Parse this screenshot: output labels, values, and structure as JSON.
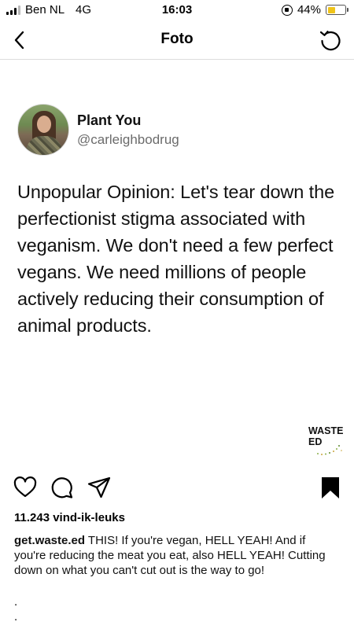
{
  "status_bar": {
    "carrier": "Ben NL",
    "network": "4G",
    "time": "16:03",
    "battery": "44%",
    "battery_level": 0.44
  },
  "nav": {
    "title": "Foto"
  },
  "post_image": {
    "profile_name": "Plant You",
    "profile_handle": "@carleighbodrug",
    "text": "Unpopular Opinion: Let's tear down the perfectionist stigma associated with veganism. We don't need a few perfect vegans. We need millions of people actively reducing their consumption of animal products.",
    "watermark_line1": "WASTE",
    "watermark_line2": "ED"
  },
  "post": {
    "likes": "11.243 vind-ik-leuks",
    "caption_user": "get.waste.ed",
    "caption_text": " THIS! If you're vegan, HELL YEAH! And if you're reducing the meat you eat, also HELL YEAH! Cutting down on what you can't cut out is the way to go!",
    "dot1": ".",
    "dot2": "."
  },
  "colors": {
    "battery_fill": "#f0c419",
    "handle_gray": "#6b6b6b",
    "divider": "#dcdcdc"
  },
  "icons": [
    "back-chevron-icon",
    "refresh-icon",
    "heart-icon",
    "comment-icon",
    "share-icon",
    "bookmark-icon"
  ]
}
